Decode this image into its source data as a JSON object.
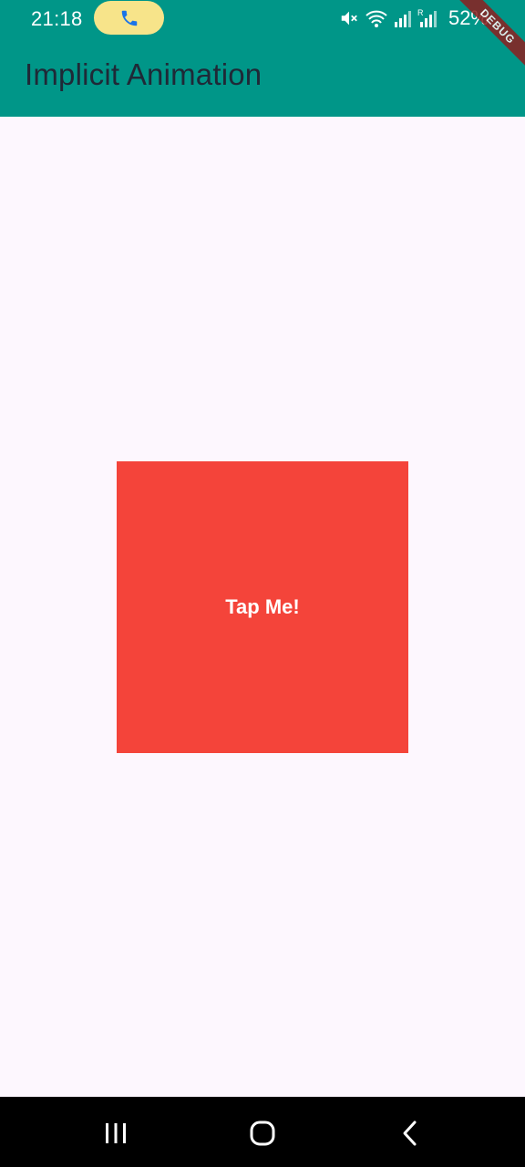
{
  "status_bar": {
    "time": "21:18",
    "battery": "52%",
    "call_pill_color": "#f7e48a",
    "icons": [
      "phone-icon",
      "mute-icon",
      "wifi-icon",
      "signal-icon",
      "signal-roaming-icon"
    ]
  },
  "app_bar": {
    "title": "Implicit Animation",
    "color": "#009688"
  },
  "debug_banner": "DEBUG",
  "main": {
    "box_label": "Tap Me!",
    "box_color": "#f4443a"
  },
  "nav_bar": {
    "icons": [
      "recent-apps-icon",
      "home-icon",
      "back-icon"
    ]
  }
}
